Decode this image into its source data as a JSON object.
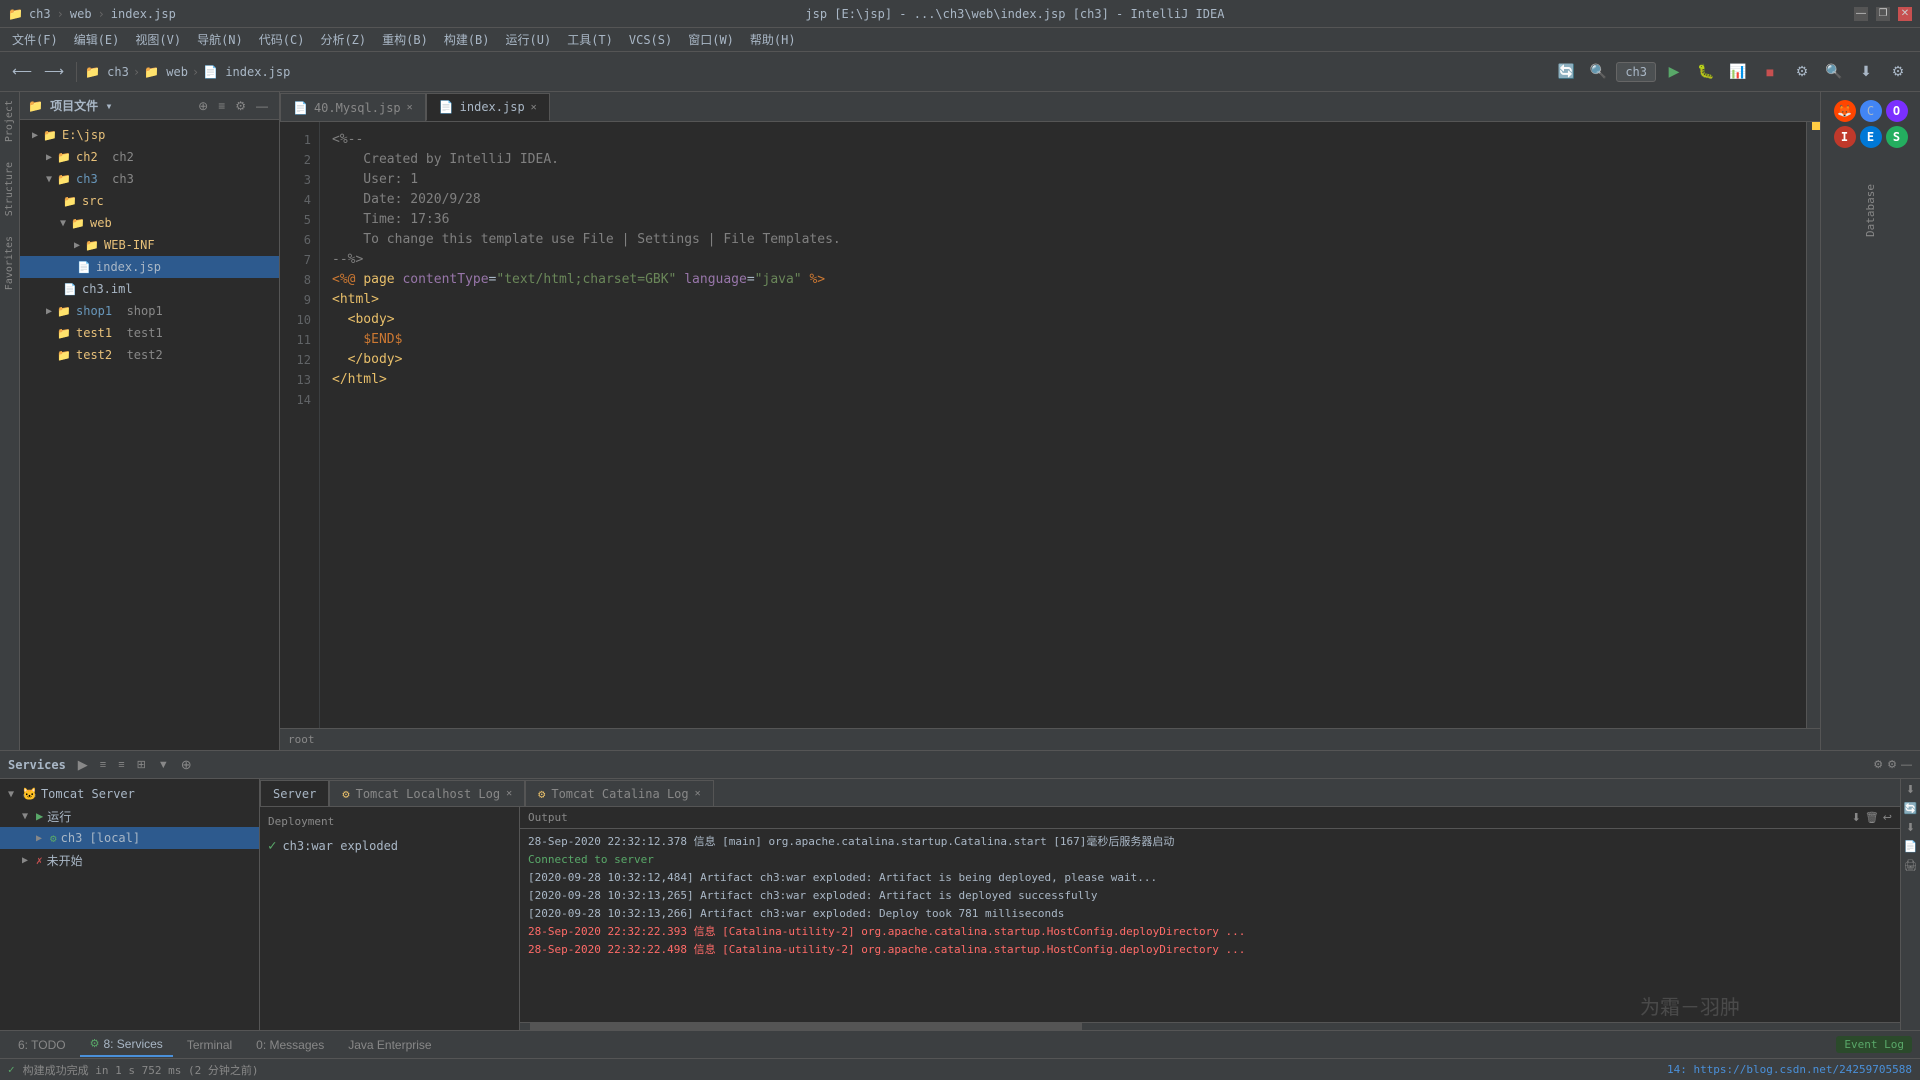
{
  "titleBar": {
    "title": "jsp [E:\\jsp] - ...\\ch3\\web\\index.jsp [ch3] - IntelliJ IDEA",
    "breadcrumb": [
      "ch3",
      "web",
      "index.jsp"
    ],
    "minBtn": "—",
    "maxBtn": "❐",
    "closeBtn": "✕"
  },
  "menuBar": {
    "items": [
      "文件(F)",
      "编辑(E)",
      "视图(V)",
      "导航(N)",
      "代码(C)",
      "分析(Z)",
      "重构(B)",
      "构建(B)",
      "运行(U)",
      "工具(T)",
      "VCS(S)",
      "窗口(W)",
      "帮助(H)"
    ]
  },
  "toolbar": {
    "breadcrumb": [
      "ch3",
      "web",
      "index.jsp"
    ],
    "runConfig": "ch3"
  },
  "projectPanel": {
    "title": "项目文件 ▾",
    "tree": [
      {
        "id": "ejsp",
        "indent": 0,
        "arrow": "▶",
        "icon": "📁",
        "label": "E:\\jsp",
        "type": "folder"
      },
      {
        "id": "ch2",
        "indent": 1,
        "arrow": "▶",
        "icon": "📁",
        "label": "ch2",
        "labelSecond": "ch2",
        "type": "folder"
      },
      {
        "id": "ch3",
        "indent": 1,
        "arrow": "▼",
        "icon": "📁",
        "label": "ch3",
        "labelSecond": "ch3",
        "type": "module"
      },
      {
        "id": "src",
        "indent": 2,
        "arrow": "",
        "icon": "📁",
        "label": "src",
        "type": "folder"
      },
      {
        "id": "web",
        "indent": 2,
        "arrow": "▼",
        "icon": "📁",
        "label": "web",
        "type": "folder"
      },
      {
        "id": "webinf",
        "indent": 3,
        "arrow": "▶",
        "icon": "📁",
        "label": "WEB-INF",
        "type": "folder"
      },
      {
        "id": "indexjsp",
        "indent": 3,
        "arrow": "",
        "icon": "📄",
        "label": "index.jsp",
        "type": "file",
        "selected": true
      },
      {
        "id": "ch3iml",
        "indent": 2,
        "arrow": "",
        "icon": "📄",
        "label": "ch3.iml",
        "type": "file"
      },
      {
        "id": "shop1",
        "indent": 1,
        "arrow": "▶",
        "icon": "📁",
        "label": "shop1",
        "labelSecond": "shop1",
        "type": "folder"
      },
      {
        "id": "test1",
        "indent": 1,
        "arrow": "",
        "icon": "📁",
        "label": "test1",
        "labelSecond": "test1",
        "type": "folder"
      },
      {
        "id": "test2",
        "indent": 1,
        "arrow": "",
        "icon": "📁",
        "label": "test2",
        "labelSecond": "test2",
        "type": "folder"
      }
    ]
  },
  "editorTabs": [
    {
      "label": "40.Mysql.jsp",
      "active": false,
      "closeable": true
    },
    {
      "label": "index.jsp",
      "active": true,
      "closeable": true
    }
  ],
  "codeEditor": {
    "filename": "index.jsp",
    "lines": [
      {
        "num": 1,
        "code": "<%--"
      },
      {
        "num": 2,
        "code": "    Created by IntelliJ IDEA."
      },
      {
        "num": 3,
        "code": "    User: 1"
      },
      {
        "num": 4,
        "code": "    Date: 2020/9/28"
      },
      {
        "num": 5,
        "code": "    Time: 17:36"
      },
      {
        "num": 6,
        "code": "    To change this template use File | Settings | File Templates."
      },
      {
        "num": 7,
        "code": "--%>"
      },
      {
        "num": 8,
        "code": "<%@ page contentType=\"text/html;charset=GBK\" language=\"java\" %>"
      },
      {
        "num": 9,
        "code": "<html>"
      },
      {
        "num": 10,
        "code": "  <body>"
      },
      {
        "num": 11,
        "code": "    $END$"
      },
      {
        "num": 12,
        "code": "  </body>"
      },
      {
        "num": 13,
        "code": "</html>"
      },
      {
        "num": 14,
        "code": ""
      }
    ],
    "footerRoot": "root"
  },
  "servicesPanel": {
    "title": "Services",
    "toolbarBtns": [
      "▶",
      "≡",
      "≡",
      "⊞",
      "▼",
      "⊕"
    ],
    "tree": [
      {
        "id": "tomcat",
        "indent": 0,
        "arrow": "▼",
        "icon": "🐱",
        "label": "Tomcat Server",
        "type": "server"
      },
      {
        "id": "running",
        "indent": 1,
        "arrow": "▼",
        "icon": "▶",
        "label": "运行",
        "type": "group"
      },
      {
        "id": "ch3local",
        "indent": 2,
        "arrow": "▶",
        "icon": "⚙",
        "label": "ch3 [local]",
        "type": "instance",
        "selected": true
      },
      {
        "id": "notstarted",
        "indent": 1,
        "arrow": "▶",
        "icon": "✗",
        "label": "未开始",
        "type": "group"
      }
    ]
  },
  "outputTabs": [
    {
      "label": "Server",
      "active": true,
      "closeable": false
    },
    {
      "label": "Tomcat Localhost Log",
      "active": false,
      "closeable": true
    },
    {
      "label": "Tomcat Catalina Log",
      "active": false,
      "closeable": true
    }
  ],
  "deployment": {
    "title": "Deployment",
    "items": [
      {
        "icon": "✓",
        "label": "ch3:war exploded",
        "color": "green"
      }
    ]
  },
  "outputTitle": "Output",
  "logLines": [
    {
      "text": "[2020-09-28 10:32:12,484] Artifact ch3:war exploded: Artifact is being deployed, please wait...",
      "type": "normal"
    },
    {
      "text": "[2020-09-28 10:32:13,265] Artifact ch3:war exploded: Artifact is deployed successfully",
      "type": "normal"
    },
    {
      "text": "[2020-09-28 10:32:13,266] Artifact ch3:war exploded: Deploy took 781 milliseconds",
      "type": "normal"
    },
    {
      "text": "28-Sep-2020 22:32:22.393 信息 [Catalina-utility-2] org.apache.catalina.startup.HostConfig.deployDirectory ...",
      "type": "red"
    },
    {
      "text": "28-Sep-2020 22:32:22.498 信息 [Catalina-utility-2] org.apache.catalina.startup.HostConfig.deployDirectory ...",
      "type": "red"
    }
  ],
  "logHeader": [
    {
      "text": "28-Sep-2020 22:32:12.378 信息 [main] org.apache.catalina.startup.Catalina.start [167]毫秒后服务器启动",
      "type": "normal"
    },
    {
      "text": "Connected to server",
      "type": "green"
    }
  ],
  "bottomTabs": [
    {
      "label": "6: TODO",
      "active": false,
      "num": "6"
    },
    {
      "label": "8: Services",
      "active": true,
      "num": "8"
    },
    {
      "label": "Terminal",
      "active": false
    },
    {
      "label": "0: Messages",
      "active": false,
      "num": "0"
    },
    {
      "label": "Java Enterprise",
      "active": false
    }
  ],
  "statusBar": {
    "left": "构建成功完成 in 1 s 752 ms (2 分钟之前)",
    "right": "14: https://blog.csdn.net/24259705588",
    "watermark": "为霜－羽肿",
    "eventLog": "Event Log"
  },
  "browserIcons": [
    "🔴",
    "🔵",
    "🟣",
    "🔴",
    "🔵",
    "🟢"
  ]
}
